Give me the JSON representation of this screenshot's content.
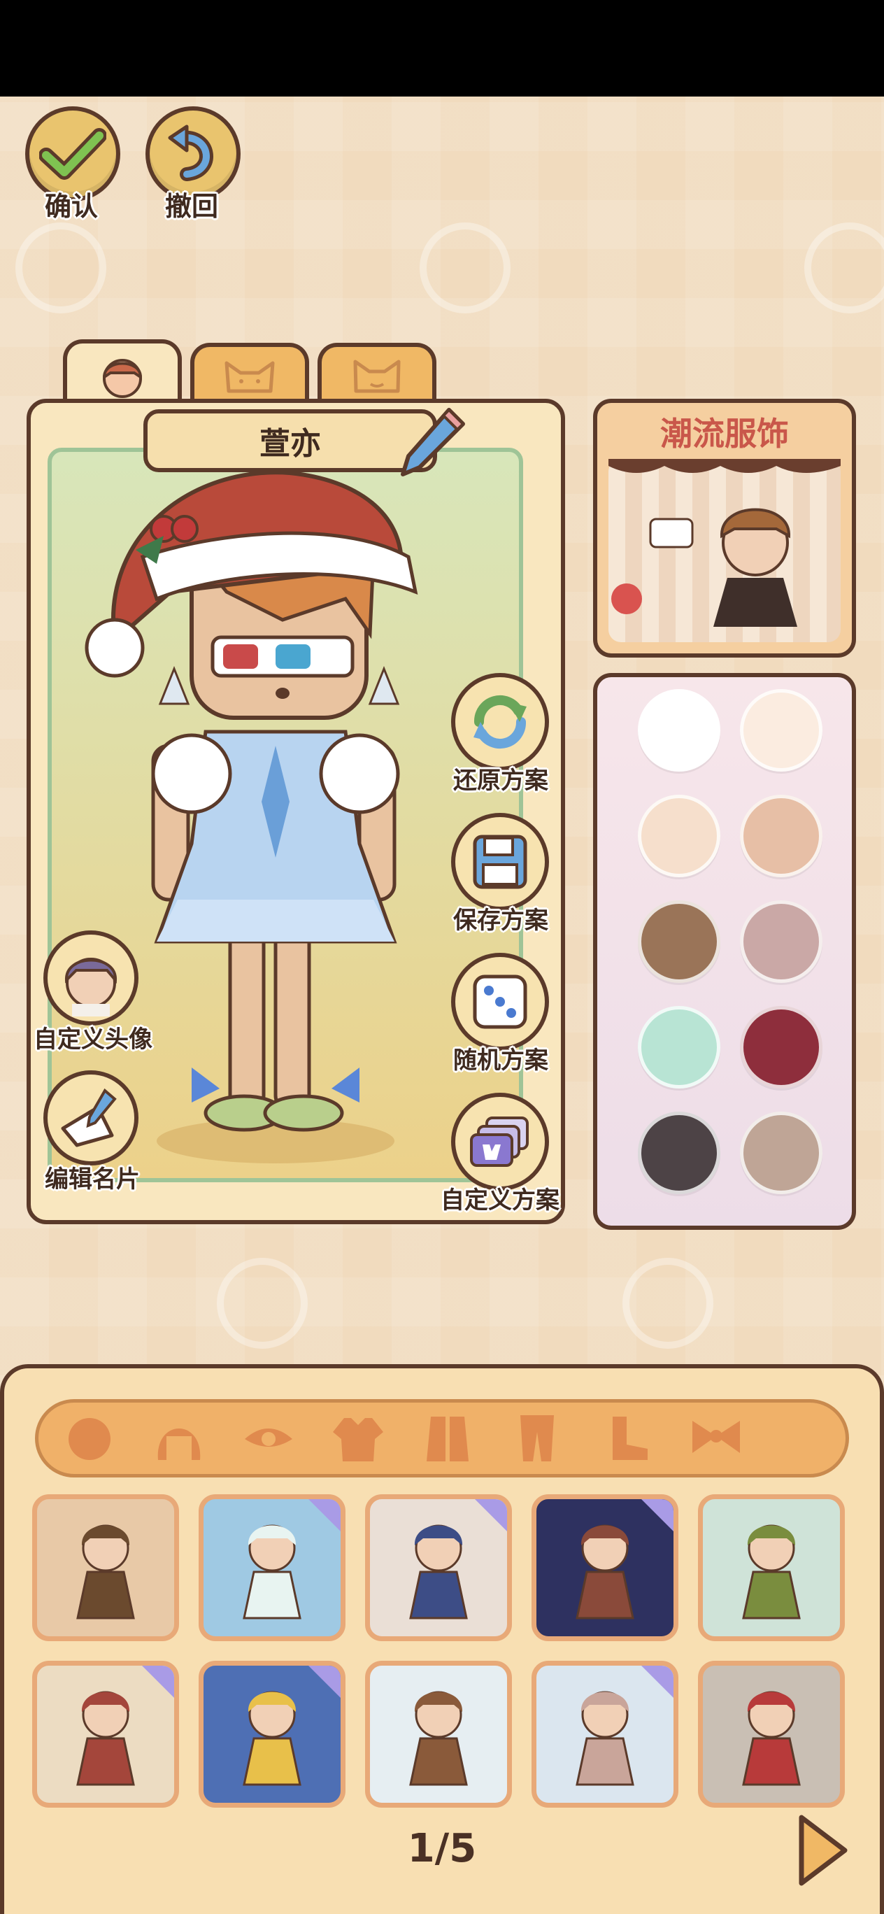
{
  "toolbar": {
    "confirm_label": "确认",
    "undo_label": "撤回"
  },
  "character": {
    "name": "萱亦",
    "tabs": [
      "person-head-icon",
      "cat-face-icon",
      "cat-smile-icon"
    ]
  },
  "side_actions": {
    "restore": "还原方案",
    "save": "保存方案",
    "random": "随机方案",
    "custom": "自定义方案",
    "custom_avatar": "自定义头像",
    "edit_card": "编辑名片"
  },
  "fashion_banner": {
    "title": "潮流服饰"
  },
  "palette": {
    "colors": [
      "#ffffff",
      "#fbece0",
      "#f6dfcc",
      "#e7bfa6",
      "#9a7458",
      "#caa8a6",
      "#b8e4d4",
      "#8e2e3c",
      "#4d4346",
      "#bfa596"
    ]
  },
  "categories": [
    "face-icon",
    "hair-icon",
    "eye-icon",
    "top-icon",
    "coat-icon",
    "pants-icon",
    "shoes-icon",
    "bow-icon"
  ],
  "outfits": [
    {
      "bg": "#e8c9a7",
      "accent": "#6b4a2e",
      "play": false
    },
    {
      "bg": "#9fc9e3",
      "accent": "#e8f4f1",
      "play": true
    },
    {
      "bg": "#eadfd6",
      "accent": "#3d4d86",
      "play": true
    },
    {
      "bg": "#2e3160",
      "accent": "#8a4a3a",
      "play": true
    },
    {
      "bg": "#cfe3d8",
      "accent": "#7a8d3e",
      "play": false
    },
    {
      "bg": "#ecdcc2",
      "accent": "#a4463b",
      "play": true
    },
    {
      "bg": "#4e6fb4",
      "accent": "#e8c04a",
      "play": true
    },
    {
      "bg": "#e6eef2",
      "accent": "#8a5a3a",
      "play": false
    },
    {
      "bg": "#dbe6ef",
      "accent": "#c9a59a",
      "play": true
    },
    {
      "bg": "#c9bfb4",
      "accent": "#b83a3a",
      "play": false
    }
  ],
  "pagination": {
    "label": "1/5",
    "current": 1,
    "total": 5
  },
  "colors": {
    "outline": "#5b3a2a",
    "button_gold": "#e9c46e",
    "tab_orange": "#f0b865",
    "title_red": "#c9574a"
  }
}
